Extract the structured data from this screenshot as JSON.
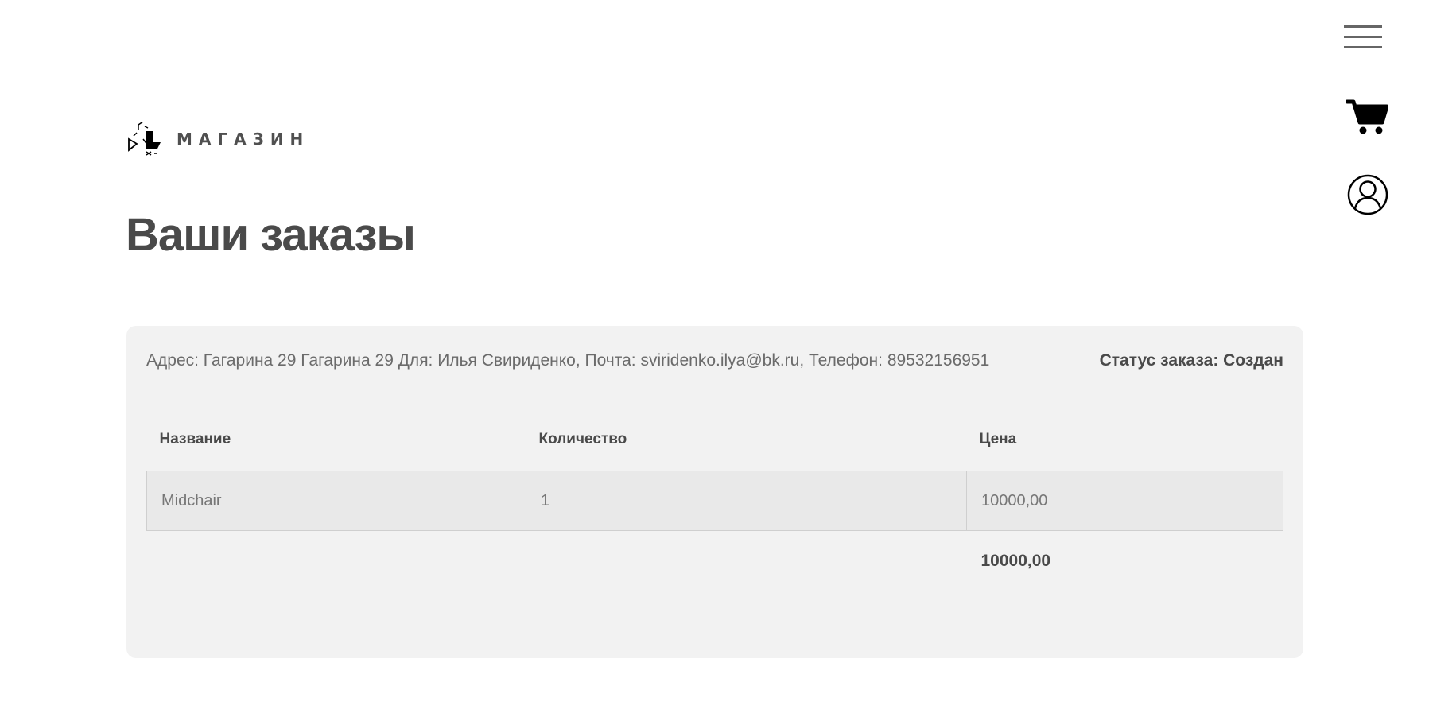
{
  "header": {
    "logo_text": "МАГАЗИН",
    "menu_icon": "hamburger-menu-icon",
    "cart_icon": "shopping-cart-icon",
    "profile_icon": "user-profile-icon"
  },
  "page": {
    "title": "Ваши заказы"
  },
  "order": {
    "info": "Адрес: Гагарина 29 Гагарина 29 Для: Илья Свириденко, Почта: sviridenko.ilya@bk.ru, Телефон: 89532156951",
    "status": "Статус заказа: Создан",
    "columns": [
      "Название",
      "Количество",
      "Цена"
    ],
    "items": [
      {
        "name": "Midchair",
        "quantity": "1",
        "price": "10000,00"
      }
    ],
    "total": "10000,00"
  },
  "colors": {
    "text_dark": "#4a4a4a",
    "text_muted": "#6b6b6b",
    "card_bg": "#f2f2f2",
    "row_bg": "#e9e9e9",
    "border": "#cfcfcf"
  }
}
